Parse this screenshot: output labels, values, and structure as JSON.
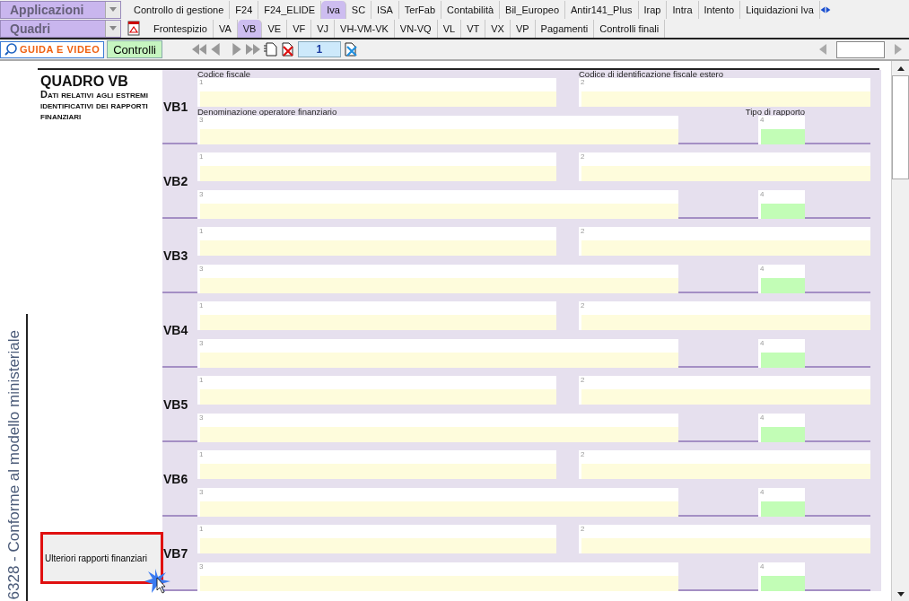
{
  "dropdowns": [
    {
      "label": "Applicazioni"
    },
    {
      "label": "Quadri"
    }
  ],
  "tabs": [
    {
      "label": "Controllo di gestione",
      "selected": false
    },
    {
      "label": "F24",
      "selected": false
    },
    {
      "label": "F24_ELIDE",
      "selected": false
    },
    {
      "label": "Iva",
      "selected": true
    },
    {
      "label": "SC",
      "selected": false
    },
    {
      "label": "ISA",
      "selected": false
    },
    {
      "label": "TerFab",
      "selected": false
    },
    {
      "label": "Contabilità",
      "selected": false
    },
    {
      "label": "Bil_Europeo",
      "selected": false
    },
    {
      "label": "Antir141_Plus",
      "selected": false
    },
    {
      "label": "Irap",
      "selected": false
    },
    {
      "label": "Intra",
      "selected": false
    },
    {
      "label": "Intento",
      "selected": false
    },
    {
      "label": "Liquidazioni Iva",
      "selected": false
    }
  ],
  "subtabs": [
    {
      "label": "Frontespizio",
      "selected": false
    },
    {
      "label": "VA",
      "selected": false
    },
    {
      "label": "VB",
      "selected": true
    },
    {
      "label": "VE",
      "selected": false
    },
    {
      "label": "VF",
      "selected": false
    },
    {
      "label": "VJ",
      "selected": false
    },
    {
      "label": "VH-VM-VK",
      "selected": false
    },
    {
      "label": "VN-VQ",
      "selected": false
    },
    {
      "label": "VL",
      "selected": false
    },
    {
      "label": "VT",
      "selected": false
    },
    {
      "label": "VX",
      "selected": false
    },
    {
      "label": "VP",
      "selected": false
    },
    {
      "label": "Pagamenti",
      "selected": false
    },
    {
      "label": "Controlli finali",
      "selected": false
    }
  ],
  "toolbar": {
    "help_button": "GUIDA E VIDEO",
    "controls_button": "Controlli",
    "page_field": "1"
  },
  "side_note": "6328 - Conforme al modello ministeriale",
  "form": {
    "title": "QUADRO VB",
    "subtitle": "Dati relativi agli estremi identificativi dei rapporti finanziari",
    "rows": [
      {
        "code": "VB1",
        "fields": [
          {
            "number": "1",
            "label": "Codice fiscale"
          },
          {
            "number": "2",
            "label": "Codice di identificazione fiscale estero"
          },
          {
            "number": "3",
            "label": "Denominazione operatore finanziario"
          },
          {
            "number": "4",
            "label": "Tipo di rapporto"
          }
        ]
      },
      {
        "code": "VB2",
        "fields": [
          {
            "number": "1"
          },
          {
            "number": "2"
          },
          {
            "number": "3"
          },
          {
            "number": "4"
          }
        ]
      },
      {
        "code": "VB3",
        "fields": [
          {
            "number": "1"
          },
          {
            "number": "2"
          },
          {
            "number": "3"
          },
          {
            "number": "4"
          }
        ]
      },
      {
        "code": "VB4",
        "fields": [
          {
            "number": "1"
          },
          {
            "number": "2"
          },
          {
            "number": "3"
          },
          {
            "number": "4"
          }
        ]
      },
      {
        "code": "VB5",
        "fields": [
          {
            "number": "1"
          },
          {
            "number": "2"
          },
          {
            "number": "3"
          },
          {
            "number": "4"
          }
        ]
      },
      {
        "code": "VB6",
        "fields": [
          {
            "number": "1"
          },
          {
            "number": "2"
          },
          {
            "number": "3"
          },
          {
            "number": "4"
          }
        ]
      },
      {
        "code": "VB7",
        "fields": [
          {
            "number": "1"
          },
          {
            "number": "2"
          },
          {
            "number": "3"
          },
          {
            "number": "4"
          }
        ]
      }
    ],
    "extra_button": {
      "label": "Ulteriori rapporti finanziari",
      "highlighted": true
    }
  }
}
